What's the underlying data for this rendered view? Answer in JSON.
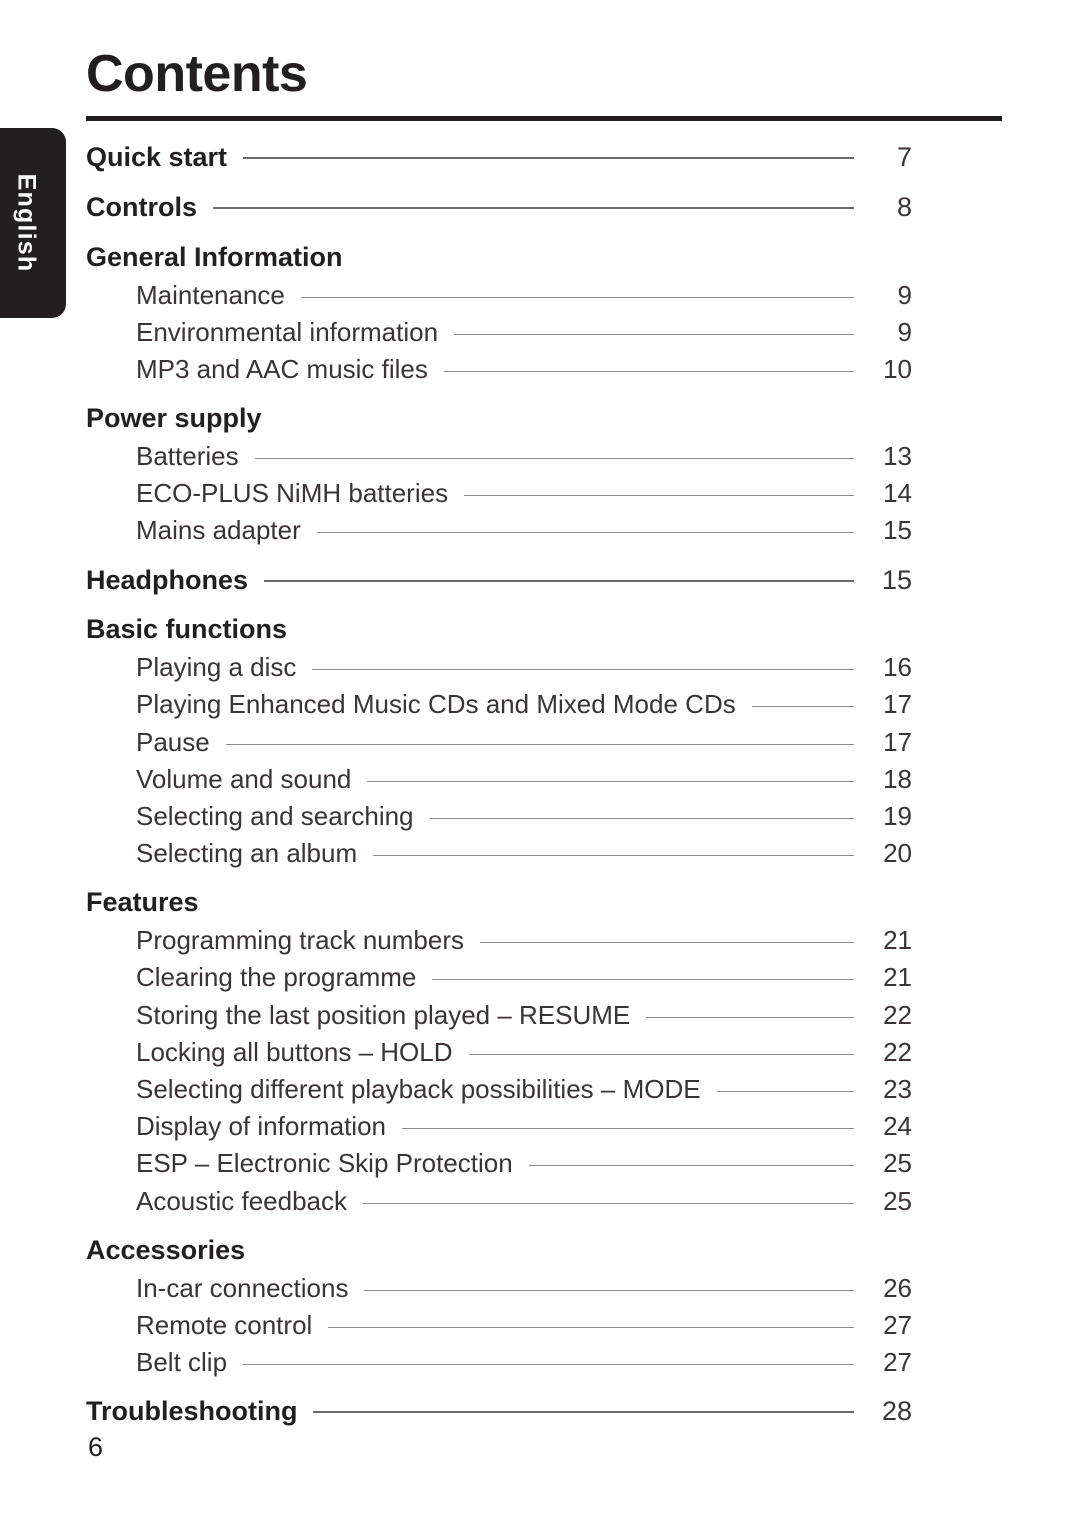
{
  "document": {
    "title": "Contents",
    "folio": "6",
    "language_tab": "English"
  },
  "toc": {
    "entries": [
      {
        "label": "Quick start",
        "page": "7",
        "level": 1,
        "has_page": true
      },
      {
        "label": "Controls",
        "page": "8",
        "level": 1,
        "has_page": true
      },
      {
        "label": "General Information",
        "page": "",
        "level": 1,
        "has_page": false
      },
      {
        "label": "Maintenance",
        "page": "9",
        "level": 2,
        "has_page": true
      },
      {
        "label": "Environmental information",
        "page": "9",
        "level": 2,
        "has_page": true
      },
      {
        "label": "MP3 and AAC music files",
        "page": "10",
        "level": 2,
        "has_page": true
      },
      {
        "label": "Power supply",
        "page": "",
        "level": 1,
        "has_page": false
      },
      {
        "label": "Batteries",
        "page": "13",
        "level": 2,
        "has_page": true
      },
      {
        "label": "ECO-PLUS NiMH batteries",
        "page": "14",
        "level": 2,
        "has_page": true
      },
      {
        "label": "Mains adapter",
        "page": "15",
        "level": 2,
        "has_page": true
      },
      {
        "label": "Headphones",
        "page": "15",
        "level": 1,
        "has_page": true
      },
      {
        "label": "Basic functions",
        "page": "",
        "level": 1,
        "has_page": false
      },
      {
        "label": "Playing a disc",
        "page": "16",
        "level": 2,
        "has_page": true
      },
      {
        "label": "Playing Enhanced Music CDs and Mixed Mode CDs",
        "page": "17",
        "level": 2,
        "has_page": true
      },
      {
        "label": "Pause",
        "page": "17",
        "level": 2,
        "has_page": true
      },
      {
        "label": "Volume and sound",
        "page": "18",
        "level": 2,
        "has_page": true
      },
      {
        "label": "Selecting and searching",
        "page": "19",
        "level": 2,
        "has_page": true
      },
      {
        "label": "Selecting an album",
        "page": "20",
        "level": 2,
        "has_page": true
      },
      {
        "label": "Features",
        "page": "",
        "level": 1,
        "has_page": false
      },
      {
        "label": "Programming track numbers",
        "page": "21",
        "level": 2,
        "has_page": true
      },
      {
        "label": "Clearing the programme",
        "page": "21",
        "level": 2,
        "has_page": true
      },
      {
        "label": "Storing the last position played – RESUME",
        "page": "22",
        "level": 2,
        "has_page": true
      },
      {
        "label": "Locking all buttons – HOLD",
        "page": "22",
        "level": 2,
        "has_page": true
      },
      {
        "label": "Selecting different playback possibilities – MODE",
        "page": "23",
        "level": 2,
        "has_page": true
      },
      {
        "label": "Display of information",
        "page": "24",
        "level": 2,
        "has_page": true
      },
      {
        "label": "ESP – Electronic Skip Protection",
        "page": "25",
        "level": 2,
        "has_page": true
      },
      {
        "label": "Acoustic feedback",
        "page": "25",
        "level": 2,
        "has_page": true
      },
      {
        "label": "Accessories",
        "page": "",
        "level": 1,
        "has_page": false
      },
      {
        "label": "In-car connections",
        "page": "26",
        "level": 2,
        "has_page": true
      },
      {
        "label": "Remote control",
        "page": "27",
        "level": 2,
        "has_page": true
      },
      {
        "label": "Belt clip",
        "page": "27",
        "level": 2,
        "has_page": true
      },
      {
        "label": "Troubleshooting",
        "page": "28",
        "level": 1,
        "has_page": true
      }
    ]
  },
  "colors": {
    "ink": "#231f20",
    "body_ink": "#3b3337",
    "leader": "#8e8a8a",
    "tab_background": "#231f20",
    "tab_text": "#ffffff"
  }
}
